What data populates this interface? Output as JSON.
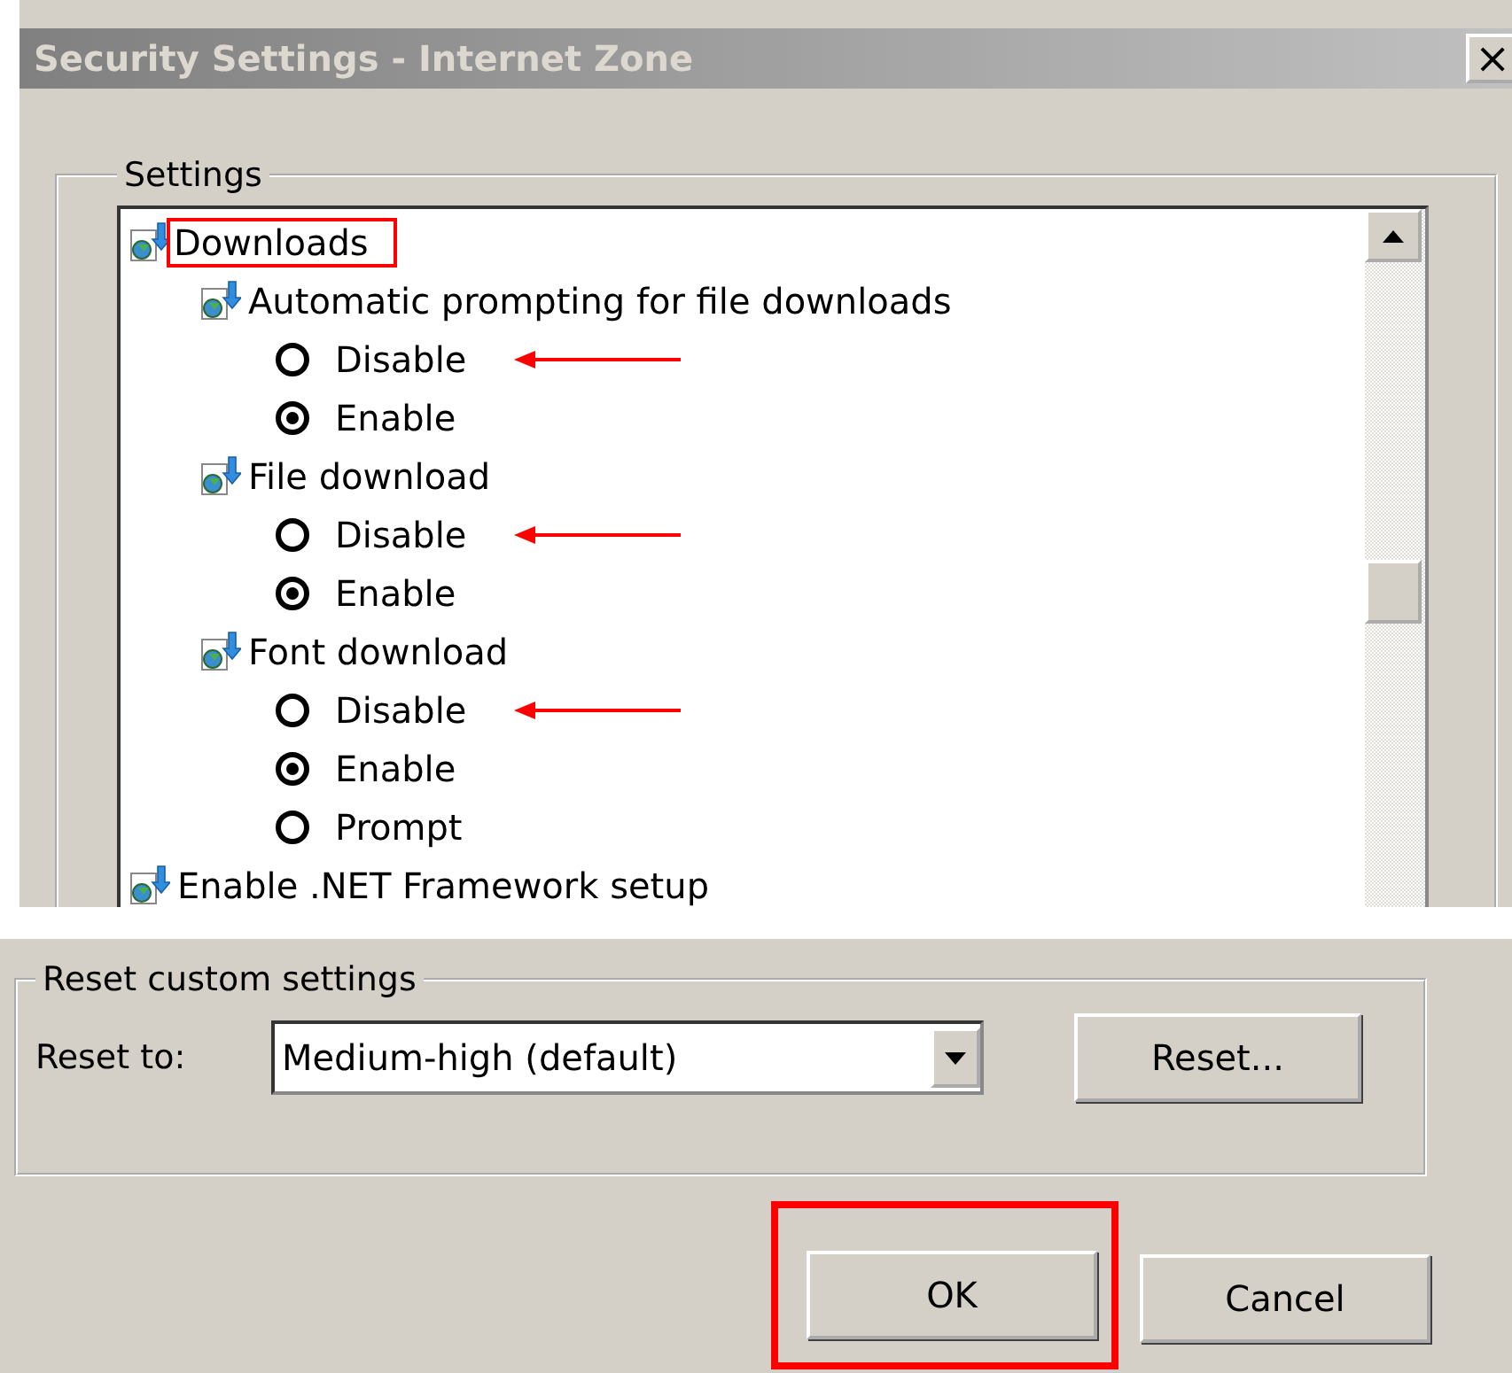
{
  "window": {
    "title": "Security Settings - Internet Zone",
    "close": "×"
  },
  "settings": {
    "legend": "Settings",
    "tree": [
      {
        "label": "Downloads",
        "kind": "folder",
        "highlighted": true,
        "children": [
          {
            "label": "Automatic prompting for file downloads",
            "kind": "setting",
            "options": [
              {
                "label": "Disable",
                "selected": false,
                "marked": true
              },
              {
                "label": "Enable",
                "selected": true,
                "marked": false
              }
            ]
          },
          {
            "label": "File download",
            "kind": "setting",
            "options": [
              {
                "label": "Disable",
                "selected": false,
                "marked": true
              },
              {
                "label": "Enable",
                "selected": true,
                "marked": false
              }
            ]
          },
          {
            "label": "Font download",
            "kind": "setting",
            "options": [
              {
                "label": "Disable",
                "selected": false,
                "marked": true
              },
              {
                "label": "Enable",
                "selected": true,
                "marked": false
              },
              {
                "label": "Prompt",
                "selected": false,
                "marked": false
              }
            ]
          }
        ]
      },
      {
        "label": "Enable .NET Framework setup",
        "kind": "folder",
        "highlighted": false
      }
    ]
  },
  "reset": {
    "legend": "Reset custom settings",
    "label": "Reset to:",
    "value": "Medium-high (default)",
    "button": "Reset..."
  },
  "buttons": [
    {
      "label": "OK",
      "highlighted": true
    },
    {
      "label": "Cancel",
      "highlighted": false
    }
  ]
}
